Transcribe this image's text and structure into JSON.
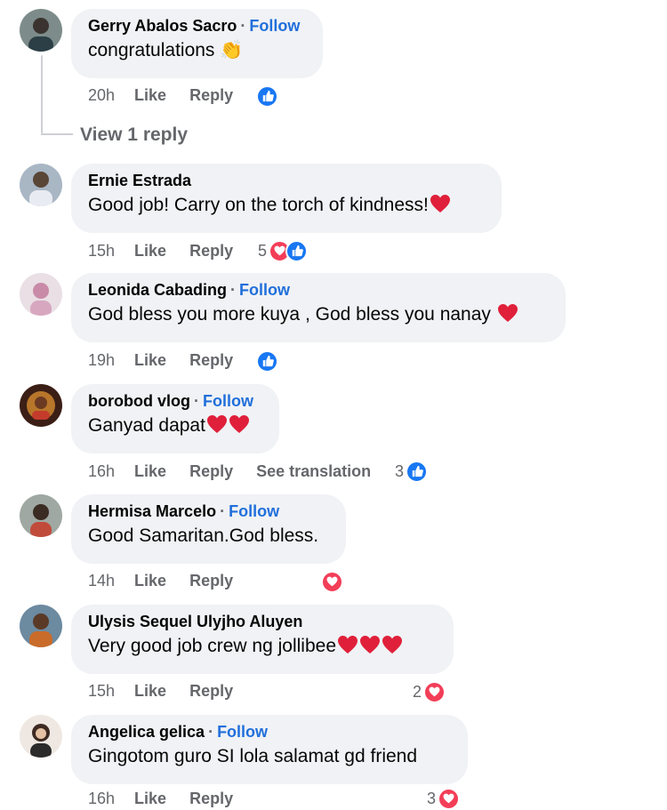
{
  "thread": {
    "view_replies": "View 1 reply"
  },
  "comments": [
    {
      "author": "Gerry Abalos Sacro",
      "follow": "Follow",
      "text": "congratulations 👏",
      "time": "20h",
      "like": "Like",
      "reply": "Reply",
      "react_count": ""
    },
    {
      "author": "Ernie Estrada",
      "follow": "",
      "text": "Good job! Carry on the torch of kindness!",
      "time": "15h",
      "like": "Like",
      "reply": "Reply",
      "react_count": "5"
    },
    {
      "author": "Leonida Cabading",
      "follow": "Follow",
      "text": "God bless you more kuya , God bless you nanay",
      "time": "19h",
      "like": "Like",
      "reply": "Reply",
      "react_count": ""
    },
    {
      "author": "borobod vlog",
      "follow": "Follow",
      "text": "Ganyad dapat",
      "time": "16h",
      "like": "Like",
      "reply": "Reply",
      "see_translation": "See translation",
      "react_count": "3"
    },
    {
      "author": "Hermisa Marcelo",
      "follow": "Follow",
      "text": "Good Samaritan.God bless.",
      "time": "14h",
      "like": "Like",
      "reply": "Reply",
      "react_count": ""
    },
    {
      "author": "Ulysis Sequel Ulyjho Aluyen",
      "follow": "",
      "text": "Very good job crew ng jollibee",
      "time": "15h",
      "like": "Like",
      "reply": "Reply",
      "react_count": "2"
    },
    {
      "author": "Angelica gelica",
      "follow": "Follow",
      "text": "Gingotom guro SI lola salamat gd friend",
      "time": "16h",
      "like": "Like",
      "reply": "Reply",
      "react_count": "3"
    }
  ],
  "colors": {
    "bubble": "#f0f2f5",
    "link": "#216fdb",
    "like": "#1877f2",
    "love": "#f33e58",
    "muted": "#65676b"
  },
  "icons": [
    "like-icon",
    "love-icon",
    "heart-emoji",
    "clap-emoji"
  ]
}
